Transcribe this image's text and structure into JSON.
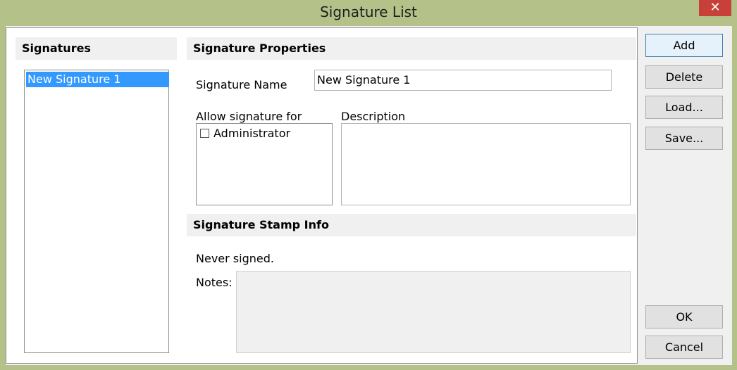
{
  "window": {
    "title": "Signature List",
    "close_glyph": "✕"
  },
  "signatures": {
    "header": "Signatures",
    "items": [
      "New Signature 1"
    ]
  },
  "properties": {
    "header": "Signature Properties",
    "name_label": "Signature Name",
    "name_value": "New Signature 1",
    "allow_label": "Allow signature for",
    "allow_items": [
      {
        "label": "Administrator",
        "checked": false
      }
    ],
    "description_label": "Description",
    "description_value": ""
  },
  "stamp_info": {
    "header": "Signature Stamp Info",
    "status": "Never signed.",
    "notes_label": "Notes:",
    "notes_value": ""
  },
  "buttons": {
    "add": "Add",
    "delete": "Delete",
    "load": "Load...",
    "save": "Save...",
    "ok": "OK",
    "cancel": "Cancel"
  },
  "colors": {
    "title_bar": "#b4c28a",
    "close_button": "#c7413a",
    "selection": "#3399ff"
  }
}
